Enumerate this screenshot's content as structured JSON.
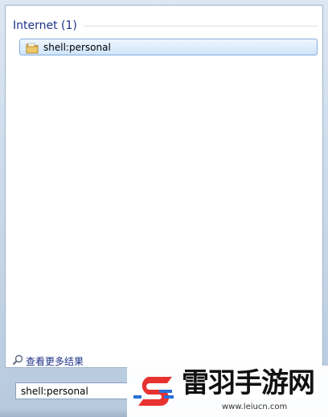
{
  "results_group": {
    "title": "Internet (1)"
  },
  "results": [
    {
      "label": "shell:personal",
      "icon": "folder-icon"
    }
  ],
  "see_more": {
    "label": "查看更多结果",
    "icon": "search-icon"
  },
  "search": {
    "value": "shell:personal"
  },
  "watermark": {
    "title": "雷羽手游网",
    "url": "www.leiucn.com"
  },
  "colors": {
    "group_title": "#1e3287",
    "selection_border": "#84acdd",
    "watermark_red": "#e8322f",
    "watermark_blue": "#2a6fd6"
  }
}
